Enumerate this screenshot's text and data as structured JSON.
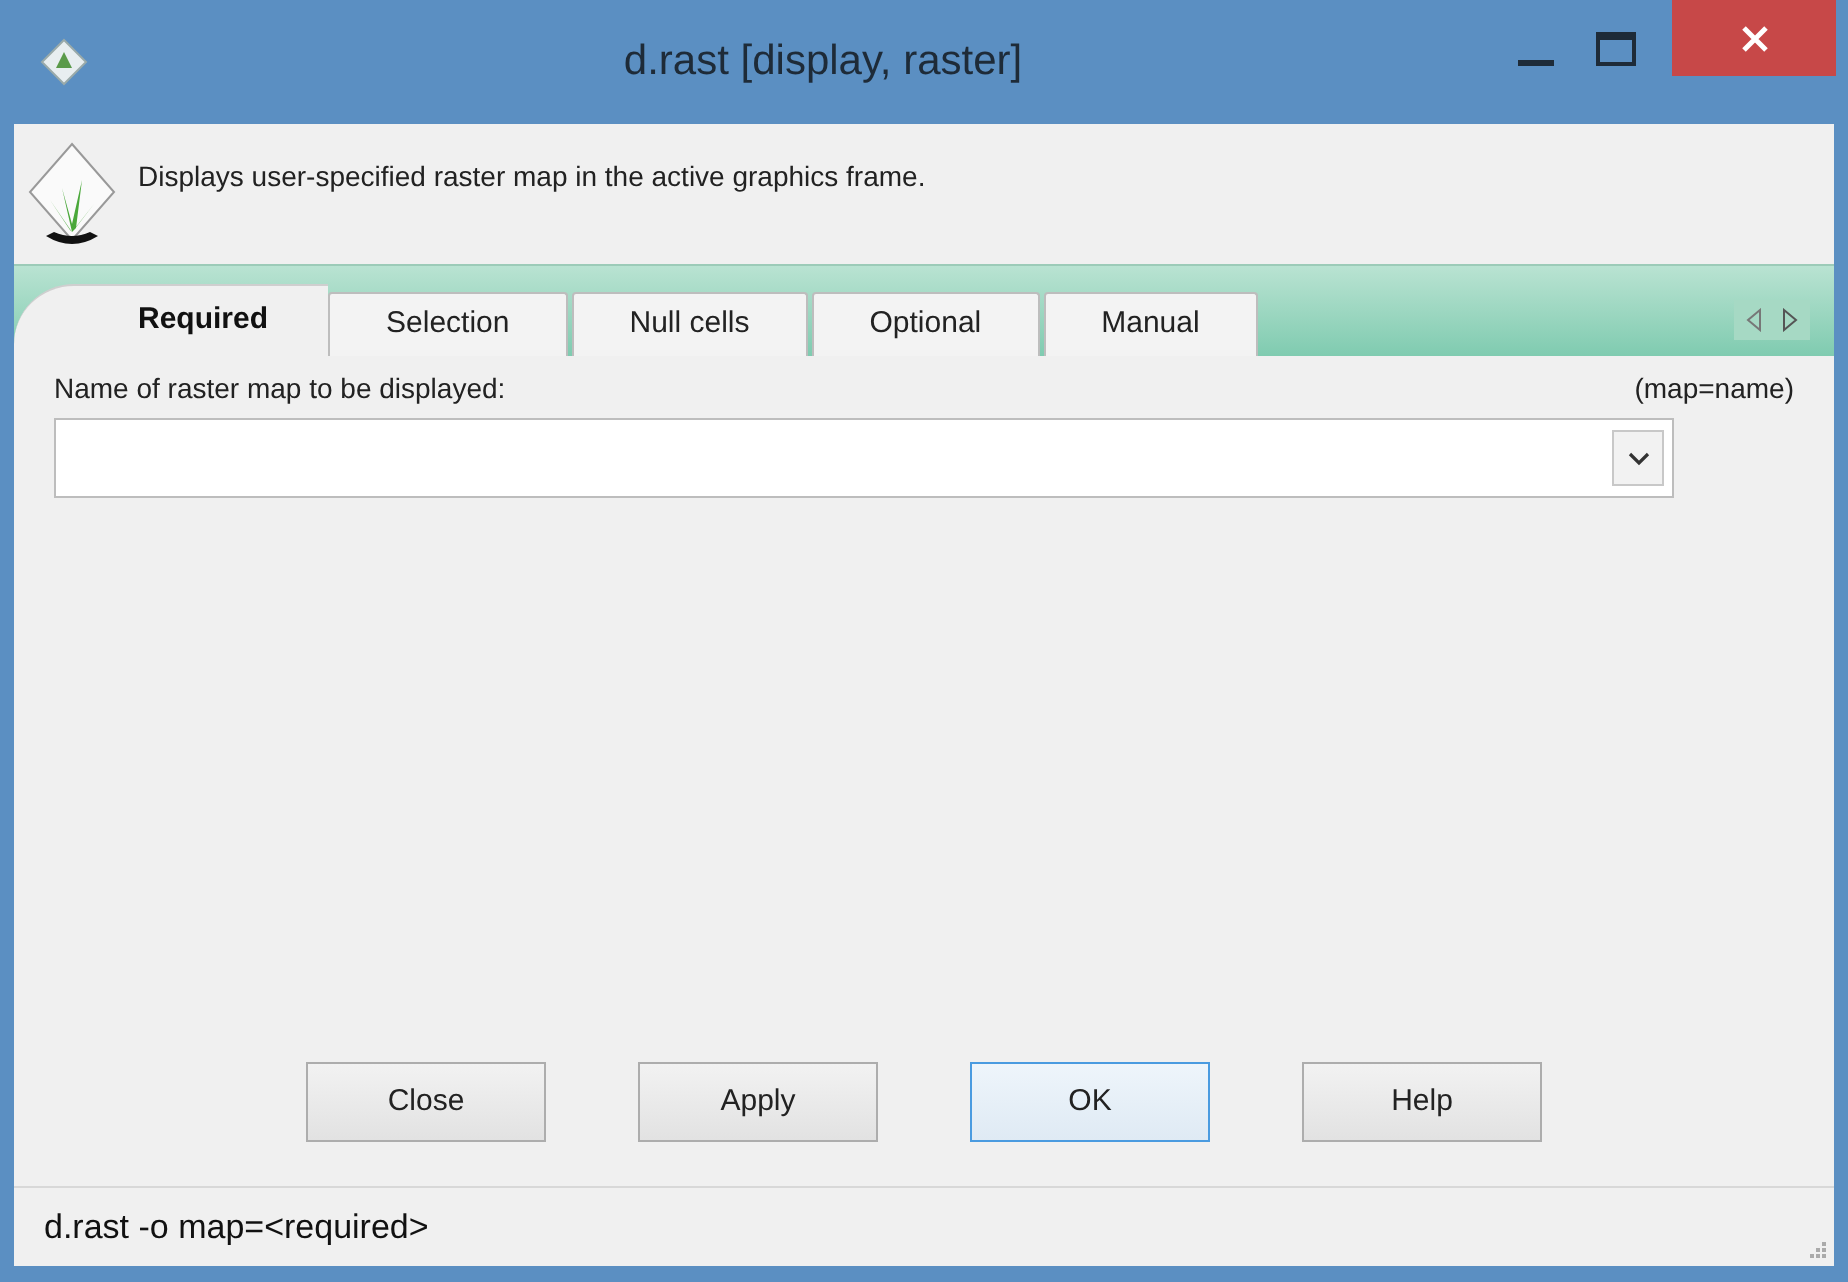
{
  "window": {
    "title": "d.rast [display, raster]"
  },
  "description": "Displays user-specified raster map in the active graphics frame.",
  "tabs": [
    {
      "label": "Required",
      "selected": true
    },
    {
      "label": "Selection",
      "selected": false
    },
    {
      "label": "Null cells",
      "selected": false
    },
    {
      "label": "Optional",
      "selected": false
    },
    {
      "label": "Manual",
      "selected": false
    }
  ],
  "field": {
    "label": "Name of raster map to be displayed:",
    "hint": "(map=name)"
  },
  "buttons": [
    {
      "label": "Close",
      "default": false
    },
    {
      "label": "Apply",
      "default": false
    },
    {
      "label": "OK",
      "default": true
    },
    {
      "label": "Help",
      "default": false
    }
  ],
  "status_bar": "d.rast -o map=<required>"
}
